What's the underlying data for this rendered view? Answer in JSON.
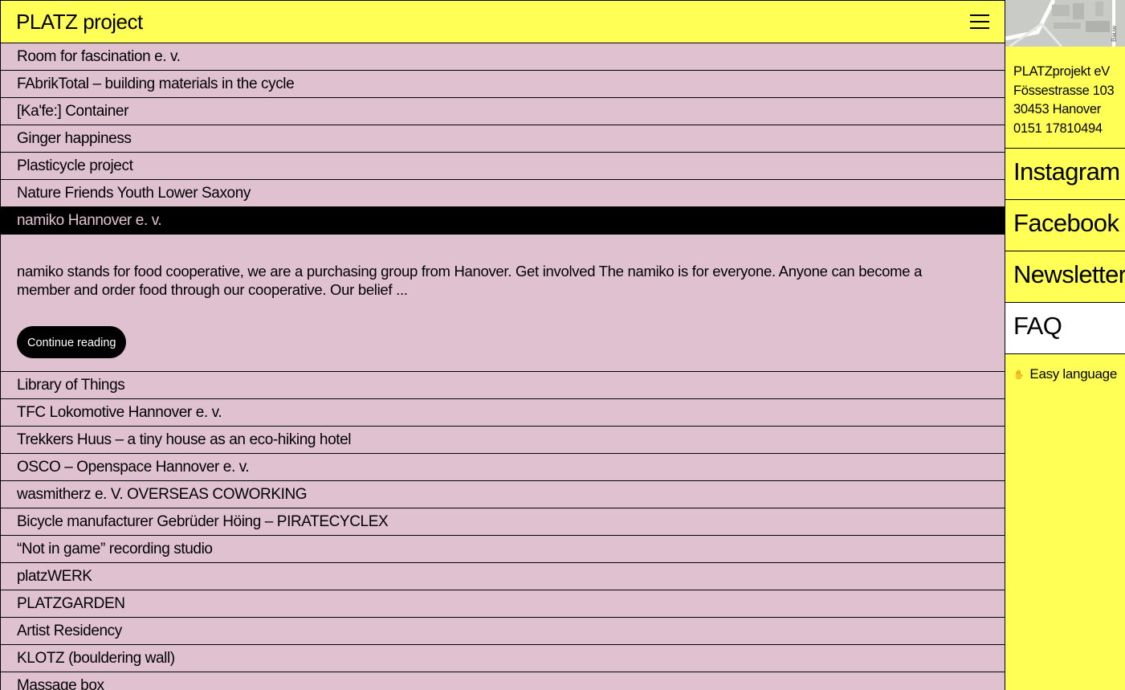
{
  "header": {
    "title": "PLATZ project"
  },
  "list": {
    "items_before": [
      "Room for fascination e. v.",
      "FAbrikTotal – building materials in the cycle",
      "[Ka'fe:] Container",
      "Ginger happiness",
      "Plasticycle project",
      "Nature Friends Youth Lower Saxony"
    ],
    "active": {
      "label": "namiko Hannover e. v.",
      "excerpt": "namiko stands for food cooperative, we are a purchasing group from Hanover. Get involved The namiko is for everyone. Anyone can become a member and order food through our cooperative. Our belief ...",
      "button": "Continue reading"
    },
    "items_after": [
      "Library of Things",
      "TFC Lokomotive Hannover e. v.",
      "Trekkers Huus – a tiny house as an eco-hiking hotel",
      "OSCO – Openspace Hannover e. v.",
      "wasmitherz e. V. OVERSEAS COWORKING",
      "Bicycle manufacturer Gebrüder Höing – PIRATECYCLEX",
      "“Not in game” recording studio",
      "platzWERK",
      "PLATZGARDEN",
      "Artist Residency",
      "KLOTZ (bouldering wall)",
      "Massage box"
    ]
  },
  "sidebar": {
    "map_label": "Bauw",
    "address": [
      "PLATZprojekt eV",
      "Fössestrasse 103",
      "30453 Hanover",
      "0151 17810494"
    ],
    "links": [
      "Instagram",
      "Facebook",
      "Newsletter",
      "FAQ"
    ],
    "easy_language": "Easy language",
    "easy_icon": "hand-icon"
  },
  "colors": {
    "yellow": "#ffff55",
    "pink": "#e0c1cf",
    "black": "#000000",
    "white": "#ffffff"
  }
}
